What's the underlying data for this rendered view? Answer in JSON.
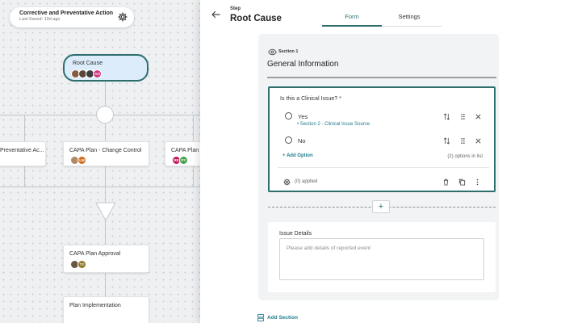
{
  "workflow": {
    "title": "Corrective and Preventative Action",
    "last_saved": "Last Saved: 19d ago"
  },
  "nodes": {
    "root_cause": {
      "title": "Root Cause",
      "avatar_badge": "AO"
    },
    "preventative": {
      "title": "Preventative Ac..."
    },
    "capa_change": {
      "title": "CAPA Plan - Change Control",
      "avatar_badge": "LM"
    },
    "capa_plan": {
      "title": "CAPA Plan",
      "avatar_badges": [
        "RE",
        "PY"
      ]
    },
    "capa_approval": {
      "title": "CAPA Plan Approval",
      "avatar_badge": "TY"
    },
    "plan_impl": {
      "title": "Plan Implementation"
    }
  },
  "panel": {
    "step_label": "Step",
    "step_title": "Root Cause",
    "tabs": [
      {
        "label": "Form",
        "active": true
      },
      {
        "label": "Settings",
        "active": false
      }
    ]
  },
  "section": {
    "label": "Section 1",
    "title": "General Information"
  },
  "question": {
    "title": "Is this a Clinical Issue? *",
    "options": [
      {
        "label": "Yes",
        "link": "• Section 2 - Clinical Issue Source"
      },
      {
        "label": "No"
      }
    ],
    "add_option": "+ Add Option",
    "option_count": "(2) options in list",
    "applied": "(0) applied"
  },
  "add_field_label": "+",
  "details": {
    "title": "Issue Details",
    "placeholder": "Please add details of reported event"
  },
  "add_section": "Add Section",
  "colors": {
    "accent": "#2d6e6e",
    "link": "#1f7a8c",
    "active_node_bg": "#dcecfb"
  }
}
